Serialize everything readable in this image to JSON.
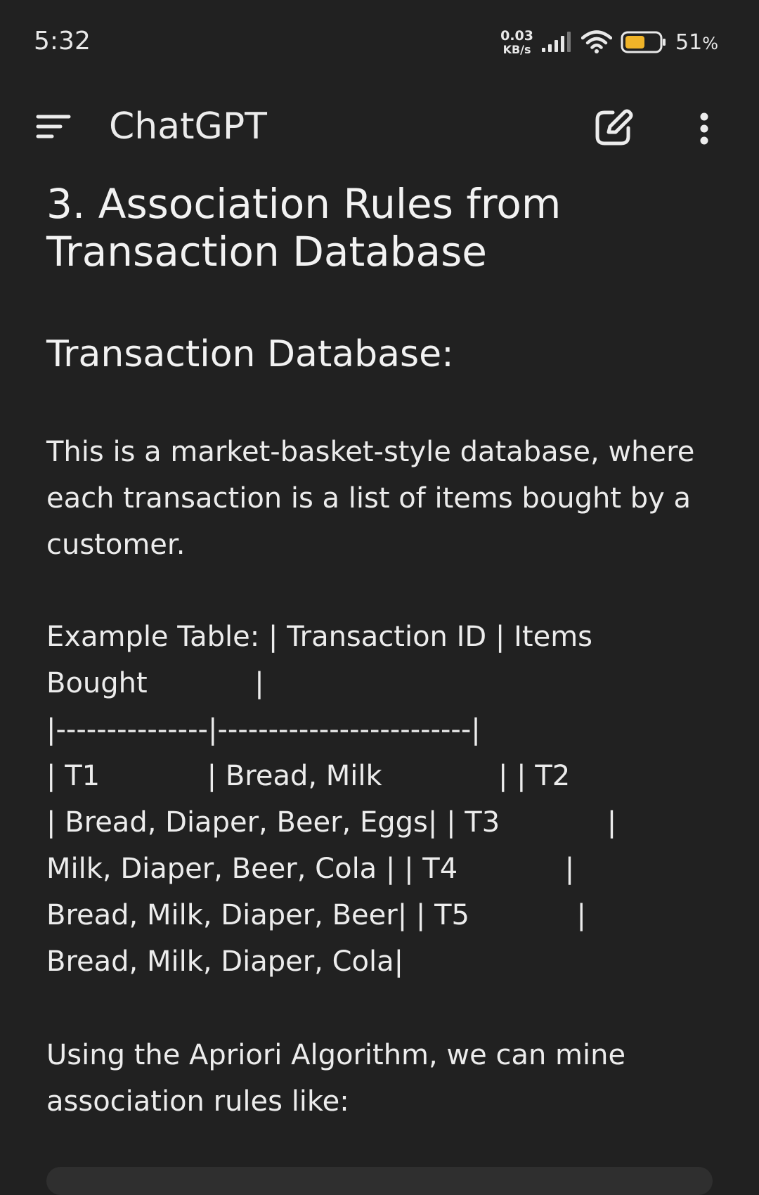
{
  "status_bar": {
    "time": "5:32",
    "net_speed_value": "0.03",
    "net_speed_unit": "KB/s",
    "battery_percent": "51",
    "battery_symbol": "%"
  },
  "app_bar": {
    "title": "ChatGPT",
    "icons": [
      "menu-icon",
      "new-chat-icon",
      "more-vert-icon"
    ]
  },
  "message": {
    "heading": "3. Association Rules from Transaction Database",
    "subheading": "Transaction Database:",
    "paragraph_1": "This is a market-basket-style database, where each transaction is a list of items bought by a customer.",
    "table_lines": [
      "Example Table: | Transaction ID | Items",
      "Bought            |",
      "|---------------|-------------------------|",
      "| T1            | Bread, Milk             | | T2",
      "| Bread, Diaper, Beer, Eggs| | T3            |",
      "Milk, Diaper, Beer, Cola | | T4            |",
      "Bread, Milk, Diaper, Beer| | T5            |",
      "Bread, Milk, Diaper, Cola|"
    ],
    "paragraph_2": "Using the Apriori Algorithm, we can mine association rules like:"
  },
  "colors": {
    "background": "#212121",
    "text": "#ececec",
    "battery_fill": "#f0b429"
  }
}
